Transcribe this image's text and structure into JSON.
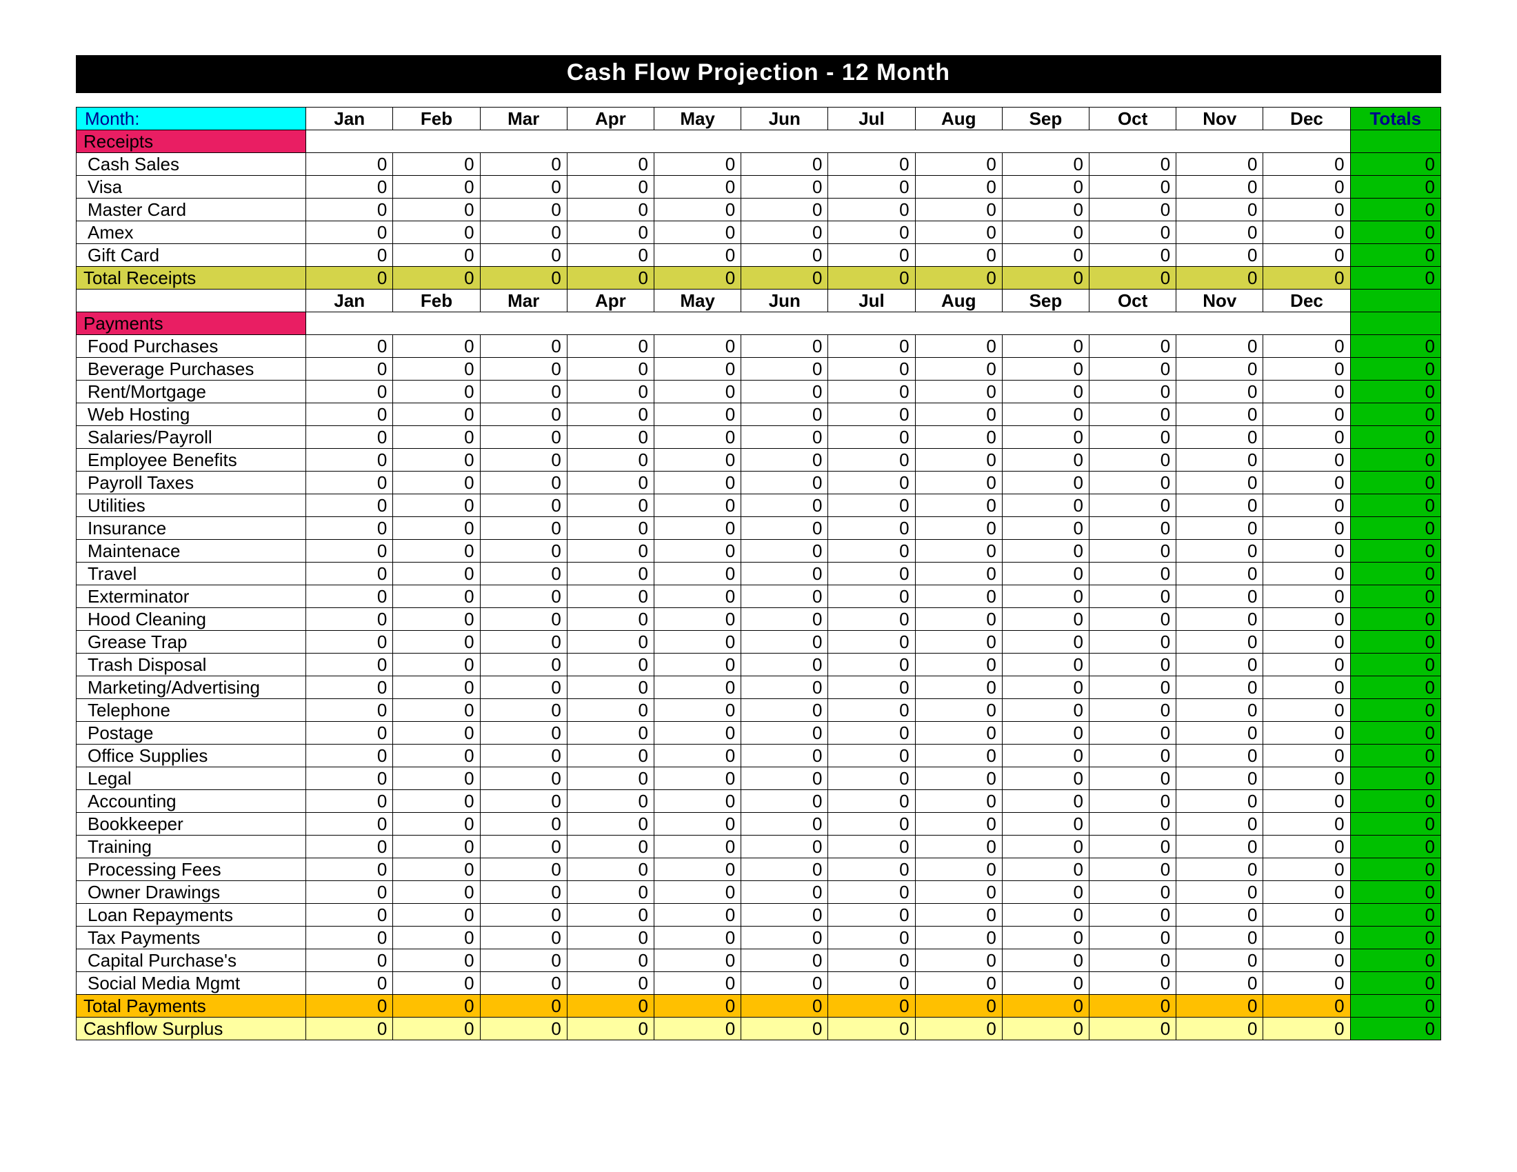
{
  "title": "Cash Flow Projection    -     12 Month",
  "month_label": "Month:",
  "months": [
    "Jan",
    "Feb",
    "Mar",
    "Apr",
    "May",
    "Jun",
    "Jul",
    "Aug",
    "Sep",
    "Oct",
    "Nov",
    "Dec"
  ],
  "totals_label": "Totals",
  "receipts_header": "Receipts",
  "receipts": [
    {
      "label": "Cash Sales",
      "values": [
        0,
        0,
        0,
        0,
        0,
        0,
        0,
        0,
        0,
        0,
        0,
        0
      ],
      "total": 0
    },
    {
      "label": "Visa",
      "values": [
        0,
        0,
        0,
        0,
        0,
        0,
        0,
        0,
        0,
        0,
        0,
        0
      ],
      "total": 0
    },
    {
      "label": "Master Card",
      "values": [
        0,
        0,
        0,
        0,
        0,
        0,
        0,
        0,
        0,
        0,
        0,
        0
      ],
      "total": 0
    },
    {
      "label": "Amex",
      "values": [
        0,
        0,
        0,
        0,
        0,
        0,
        0,
        0,
        0,
        0,
        0,
        0
      ],
      "total": 0
    },
    {
      "label": "Gift Card",
      "values": [
        0,
        0,
        0,
        0,
        0,
        0,
        0,
        0,
        0,
        0,
        0,
        0
      ],
      "total": 0
    }
  ],
  "total_receipts": {
    "label": "Total Receipts",
    "values": [
      0,
      0,
      0,
      0,
      0,
      0,
      0,
      0,
      0,
      0,
      0,
      0
    ],
    "total": 0
  },
  "payments_header": "Payments",
  "payments": [
    {
      "label": "Food Purchases",
      "values": [
        0,
        0,
        0,
        0,
        0,
        0,
        0,
        0,
        0,
        0,
        0,
        0
      ],
      "total": 0
    },
    {
      "label": "Beverage Purchases",
      "values": [
        0,
        0,
        0,
        0,
        0,
        0,
        0,
        0,
        0,
        0,
        0,
        0
      ],
      "total": 0
    },
    {
      "label": "Rent/Mortgage",
      "values": [
        0,
        0,
        0,
        0,
        0,
        0,
        0,
        0,
        0,
        0,
        0,
        0
      ],
      "total": 0
    },
    {
      "label": "Web Hosting",
      "values": [
        0,
        0,
        0,
        0,
        0,
        0,
        0,
        0,
        0,
        0,
        0,
        0
      ],
      "total": 0
    },
    {
      "label": "Salaries/Payroll",
      "values": [
        0,
        0,
        0,
        0,
        0,
        0,
        0,
        0,
        0,
        0,
        0,
        0
      ],
      "total": 0
    },
    {
      "label": "Employee Benefits",
      "values": [
        0,
        0,
        0,
        0,
        0,
        0,
        0,
        0,
        0,
        0,
        0,
        0
      ],
      "total": 0
    },
    {
      "label": "Payroll Taxes",
      "values": [
        0,
        0,
        0,
        0,
        0,
        0,
        0,
        0,
        0,
        0,
        0,
        0
      ],
      "total": 0
    },
    {
      "label": "Utilities",
      "values": [
        0,
        0,
        0,
        0,
        0,
        0,
        0,
        0,
        0,
        0,
        0,
        0
      ],
      "total": 0
    },
    {
      "label": "Insurance",
      "values": [
        0,
        0,
        0,
        0,
        0,
        0,
        0,
        0,
        0,
        0,
        0,
        0
      ],
      "total": 0
    },
    {
      "label": "Maintenace",
      "values": [
        0,
        0,
        0,
        0,
        0,
        0,
        0,
        0,
        0,
        0,
        0,
        0
      ],
      "total": 0
    },
    {
      "label": "Travel",
      "values": [
        0,
        0,
        0,
        0,
        0,
        0,
        0,
        0,
        0,
        0,
        0,
        0
      ],
      "total": 0
    },
    {
      "label": "Exterminator",
      "values": [
        0,
        0,
        0,
        0,
        0,
        0,
        0,
        0,
        0,
        0,
        0,
        0
      ],
      "total": 0
    },
    {
      "label": "Hood Cleaning",
      "values": [
        0,
        0,
        0,
        0,
        0,
        0,
        0,
        0,
        0,
        0,
        0,
        0
      ],
      "total": 0
    },
    {
      "label": "Grease Trap",
      "values": [
        0,
        0,
        0,
        0,
        0,
        0,
        0,
        0,
        0,
        0,
        0,
        0
      ],
      "total": 0
    },
    {
      "label": "Trash Disposal",
      "values": [
        0,
        0,
        0,
        0,
        0,
        0,
        0,
        0,
        0,
        0,
        0,
        0
      ],
      "total": 0
    },
    {
      "label": "Marketing/Advertising",
      "values": [
        0,
        0,
        0,
        0,
        0,
        0,
        0,
        0,
        0,
        0,
        0,
        0
      ],
      "total": 0
    },
    {
      "label": "Telephone",
      "values": [
        0,
        0,
        0,
        0,
        0,
        0,
        0,
        0,
        0,
        0,
        0,
        0
      ],
      "total": 0
    },
    {
      "label": "Postage",
      "values": [
        0,
        0,
        0,
        0,
        0,
        0,
        0,
        0,
        0,
        0,
        0,
        0
      ],
      "total": 0
    },
    {
      "label": "Office Supplies",
      "values": [
        0,
        0,
        0,
        0,
        0,
        0,
        0,
        0,
        0,
        0,
        0,
        0
      ],
      "total": 0
    },
    {
      "label": "Legal",
      "values": [
        0,
        0,
        0,
        0,
        0,
        0,
        0,
        0,
        0,
        0,
        0,
        0
      ],
      "total": 0
    },
    {
      "label": "Accounting",
      "values": [
        0,
        0,
        0,
        0,
        0,
        0,
        0,
        0,
        0,
        0,
        0,
        0
      ],
      "total": 0
    },
    {
      "label": "Bookkeeper",
      "values": [
        0,
        0,
        0,
        0,
        0,
        0,
        0,
        0,
        0,
        0,
        0,
        0
      ],
      "total": 0
    },
    {
      "label": "Training",
      "values": [
        0,
        0,
        0,
        0,
        0,
        0,
        0,
        0,
        0,
        0,
        0,
        0
      ],
      "total": 0
    },
    {
      "label": "Processing Fees",
      "values": [
        0,
        0,
        0,
        0,
        0,
        0,
        0,
        0,
        0,
        0,
        0,
        0
      ],
      "total": 0
    },
    {
      "label": "Owner Drawings",
      "values": [
        0,
        0,
        0,
        0,
        0,
        0,
        0,
        0,
        0,
        0,
        0,
        0
      ],
      "total": 0
    },
    {
      "label": "Loan Repayments",
      "values": [
        0,
        0,
        0,
        0,
        0,
        0,
        0,
        0,
        0,
        0,
        0,
        0
      ],
      "total": 0
    },
    {
      "label": "Tax Payments",
      "values": [
        0,
        0,
        0,
        0,
        0,
        0,
        0,
        0,
        0,
        0,
        0,
        0
      ],
      "total": 0
    },
    {
      "label": "Capital Purchase's",
      "values": [
        0,
        0,
        0,
        0,
        0,
        0,
        0,
        0,
        0,
        0,
        0,
        0
      ],
      "total": 0
    },
    {
      "label": "Social Media Mgmt",
      "values": [
        0,
        0,
        0,
        0,
        0,
        0,
        0,
        0,
        0,
        0,
        0,
        0
      ],
      "total": 0
    }
  ],
  "total_payments": {
    "label": "Total Payments",
    "values": [
      0,
      0,
      0,
      0,
      0,
      0,
      0,
      0,
      0,
      0,
      0,
      0
    ],
    "total": 0
  },
  "surplus": {
    "label": "Cashflow Surplus",
    "values": [
      0,
      0,
      0,
      0,
      0,
      0,
      0,
      0,
      0,
      0,
      0,
      0
    ],
    "total": 0
  }
}
